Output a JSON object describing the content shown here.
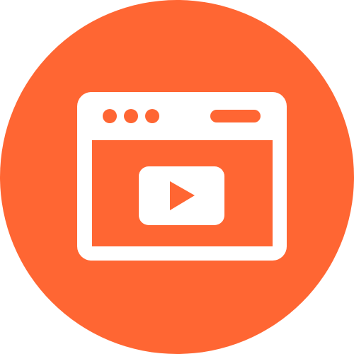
{
  "icon": {
    "name": "browser-video-icon",
    "colors": {
      "background": "#FF6633",
      "foreground": "#FFFFFF",
      "page": "#FFFFFF"
    }
  }
}
